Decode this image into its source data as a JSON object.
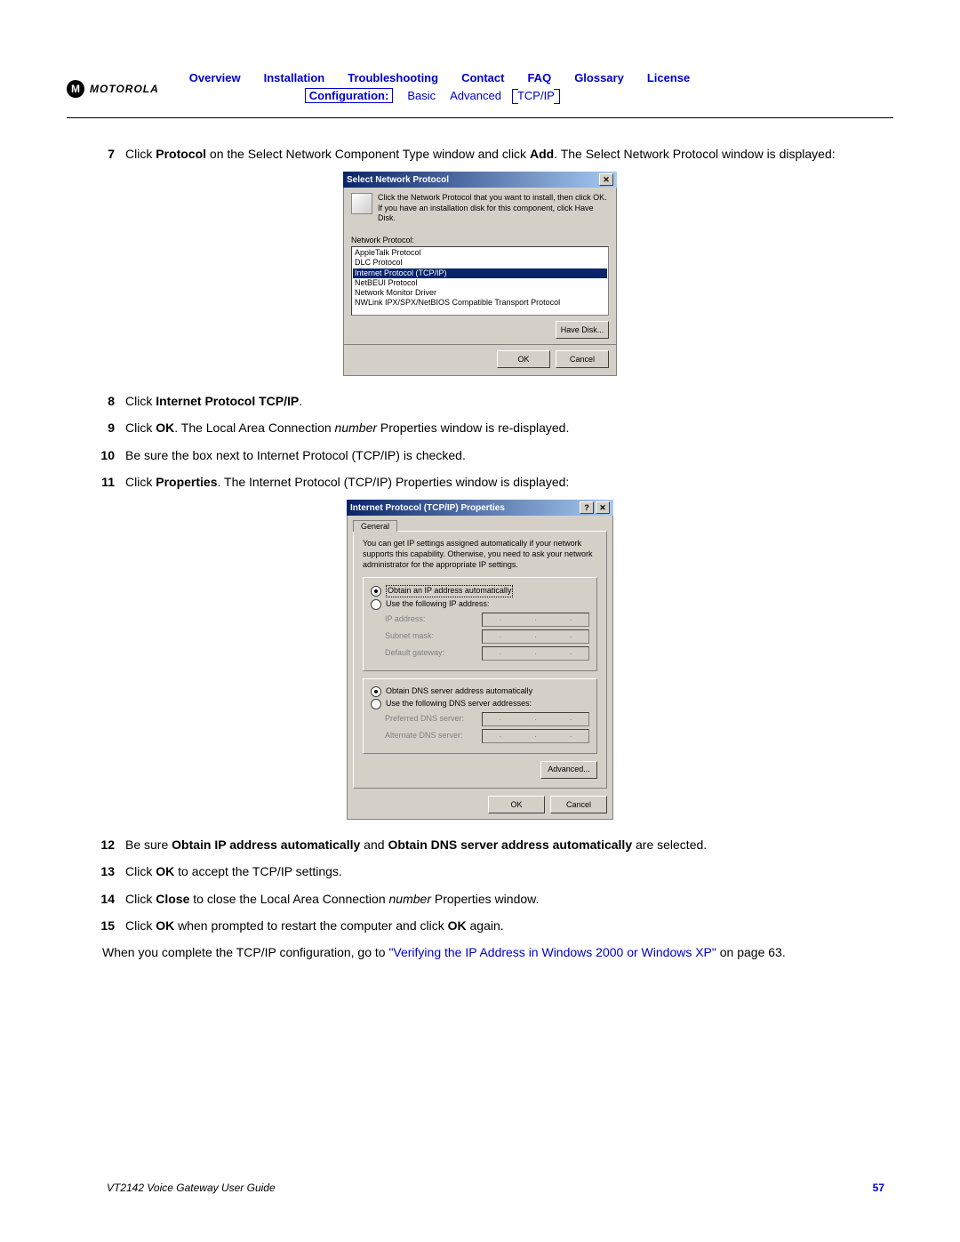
{
  "header": {
    "logo_text": "MOTOROLA",
    "nav": {
      "overview": "Overview",
      "installation": "Installation",
      "troubleshooting": "Troubleshooting",
      "contact": "Contact",
      "faq": "FAQ",
      "glossary": "Glossary",
      "license": "License"
    },
    "subnav": {
      "configuration": "Configuration:",
      "basic": "Basic",
      "advanced": "Advanced",
      "tcpip": "TCP/IP"
    }
  },
  "steps": {
    "s7": {
      "num": "7",
      "pre": "Click ",
      "b1": "Protocol",
      "mid": " on the Select Network Component Type window and click ",
      "b2": "Add",
      "post": ". The Select Network Protocol window is displayed:"
    },
    "s8": {
      "num": "8",
      "pre": "Click ",
      "b": "Internet Protocol TCP/IP",
      "post": "."
    },
    "s9": {
      "num": "9",
      "pre": "Click ",
      "b": "OK",
      "mid": ". The Local Area Connection ",
      "i": "number",
      "post": " Properties window is re-displayed."
    },
    "s10": {
      "num": "10",
      "text": "Be sure the box next to Internet Protocol (TCP/IP) is checked."
    },
    "s11": {
      "num": "11",
      "pre": "Click ",
      "b": "Properties",
      "post": ". The Internet Protocol (TCP/IP) Properties window is displayed:"
    },
    "s12": {
      "num": "12",
      "pre": "Be sure ",
      "b1": "Obtain IP address automatically",
      "mid": " and ",
      "b2": "Obtain DNS server address automatically",
      "post": " are selected."
    },
    "s13": {
      "num": "13",
      "pre": "Click ",
      "b": "OK",
      "post": " to accept the TCP/IP settings."
    },
    "s14": {
      "num": "14",
      "pre": "Click ",
      "b": "Close",
      "mid": " to close the Local Area Connection ",
      "i": "number",
      "post": " Properties window."
    },
    "s15": {
      "num": "15",
      "pre": "Click ",
      "b1": "OK",
      "mid": " when prompted to restart the computer and click ",
      "b2": "OK",
      "post": " again."
    }
  },
  "final": {
    "pre": "When you complete the TCP/IP configuration, go to ",
    "link": "\"Verifying the IP Address in Windows 2000 or Windows XP\"",
    "post": " on page 63."
  },
  "dialog1": {
    "title": "Select Network Protocol",
    "desc": "Click the Network Protocol that you want to install, then click OK. If you have an installation disk for this component, click Have Disk.",
    "label": "Network Protocol:",
    "items": {
      "p0": "AppleTalk Protocol",
      "p1": "DLC Protocol",
      "p2": "Internet Protocol (TCP/IP)",
      "p3": "NetBEUI Protocol",
      "p4": "Network Monitor Driver",
      "p5": "NWLink IPX/SPX/NetBIOS Compatible Transport Protocol"
    },
    "buttons": {
      "have_disk": "Have Disk...",
      "ok": "OK",
      "cancel": "Cancel"
    }
  },
  "dialog2": {
    "title": "Internet Protocol (TCP/IP) Properties",
    "tab": "General",
    "desc": "You can get IP settings assigned automatically if your network supports this capability. Otherwise, you need to ask your network administrator for the appropriate IP settings.",
    "radio_ip_auto": "Obtain an IP address automatically",
    "radio_ip_manual": "Use the following IP address:",
    "ip_address": "IP address:",
    "subnet": "Subnet mask:",
    "gateway": "Default gateway:",
    "radio_dns_auto": "Obtain DNS server address automatically",
    "radio_dns_manual": "Use the following DNS server addresses:",
    "pref_dns": "Preferred DNS server:",
    "alt_dns": "Alternate DNS server:",
    "advanced": "Advanced...",
    "ok": "OK",
    "cancel": "Cancel"
  },
  "footer": {
    "title": "VT2142 Voice Gateway User Guide",
    "page": "57"
  }
}
